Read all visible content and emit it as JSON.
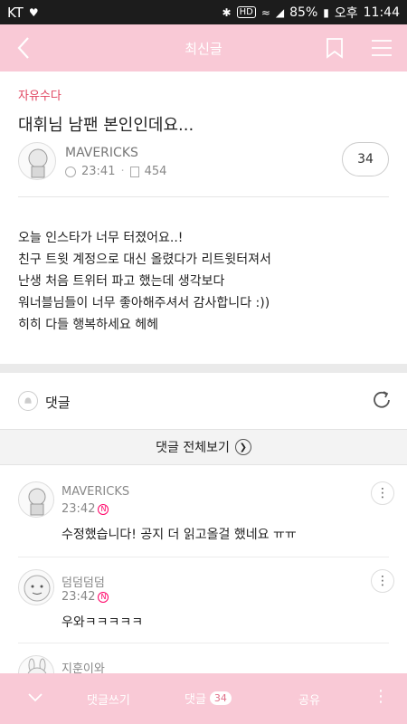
{
  "status_bar": {
    "carrier": "KT",
    "battery": "85%",
    "ampm": "오후",
    "time": "11:44",
    "hd_label": "HD"
  },
  "header": {
    "title": "최신글"
  },
  "post": {
    "category": "자유수다",
    "title": "대휘님 남팬 본인인데요...",
    "author": "MAVERICKS",
    "time": "23:41",
    "views": "454",
    "comment_count": "34",
    "body_lines": [
      "오늘 인스타가 너무 터졌어요..!",
      "친구 트윗 계정으로 대신 올렸다가 리트윗터져서",
      "난생 처음 트위터 파고 했는데 생각보다",
      "워너블님들이 너무 좋아해주셔서 감사합니다 :))",
      "히히 다들 행복하세요 헤헤"
    ]
  },
  "comments_section": {
    "label": "댓글",
    "view_all_label": "댓글 전체보기",
    "items": [
      {
        "name": "MAVERICKS",
        "time": "23:42",
        "new_badge": "N",
        "text": "수정했습니다! 공지 더 읽고올걸 했네요 ㅠㅠ"
      },
      {
        "name": "덤덤덤덤",
        "time": "23:42",
        "new_badge": "N",
        "text": "우와ㅋㅋㅋㅋㅋ"
      },
      {
        "name": "지훈이와"
      }
    ]
  },
  "bottom_bar": {
    "write_label": "댓글쓰기",
    "comment_label": "댓글",
    "comment_count": "34",
    "share_label": "공유"
  },
  "colors": {
    "header_pink": "#f9c9d6",
    "category_red": "#e0455f",
    "status_dark": "#1c1c1c"
  },
  "icons": [
    "back-icon",
    "bookmark-icon",
    "menu-icon",
    "clock-icon",
    "views-icon",
    "bell-icon",
    "refresh-icon",
    "chevron-right-icon",
    "more-vertical-icon",
    "chevron-down-icon",
    "heart-icon",
    "bluetooth-icon",
    "wifi-icon",
    "signal-icon",
    "battery-icon"
  ]
}
